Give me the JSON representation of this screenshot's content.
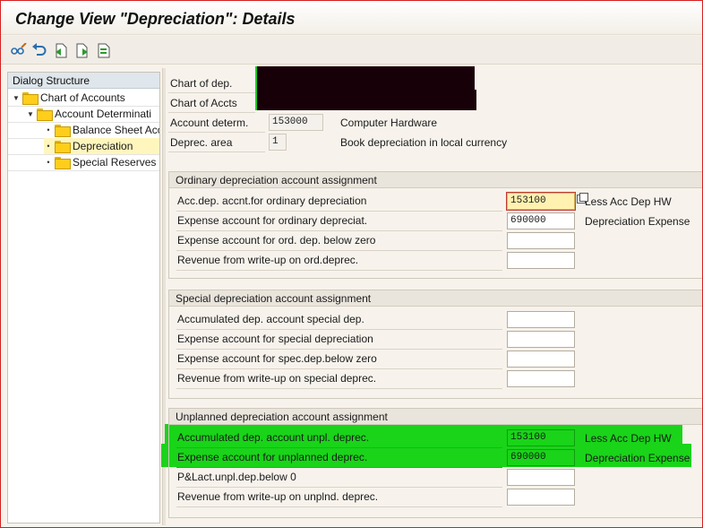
{
  "title": "Change View \"Depreciation\": Details",
  "toolbar": {
    "buttons": [
      {
        "name": "display-change-button",
        "icon": "glasses-pencil-icon"
      },
      {
        "name": "undo-button",
        "icon": "undo-icon"
      },
      {
        "name": "previous-entry-button",
        "icon": "previous-entry-icon"
      },
      {
        "name": "next-entry-button",
        "icon": "next-entry-icon"
      },
      {
        "name": "variable-list-button",
        "icon": "list-icon"
      }
    ]
  },
  "dialog_structure": {
    "heading": "Dialog Structure",
    "items": [
      {
        "label": "Chart of Accounts",
        "level": 0,
        "expanded": true
      },
      {
        "label": "Account Determinati",
        "level": 1,
        "expanded": true
      },
      {
        "label": "Balance Sheet Acc",
        "level": 2
      },
      {
        "label": "Depreciation",
        "level": 2,
        "selected": true
      },
      {
        "label": "Special Reserves",
        "level": 2
      }
    ]
  },
  "header_fields": {
    "chart_of_dep_label": "Chart of dep.",
    "chart_of_accts_label": "Chart of Accts",
    "account_determ_label": "Account determ.",
    "account_determ_value": "153000",
    "account_determ_text": "Computer Hardware",
    "deprec_area_label": "Deprec. area",
    "deprec_area_value": "1",
    "deprec_area_text": "Book depreciation in local currency"
  },
  "groups": {
    "ordinary": {
      "title": "Ordinary depreciation account assignment",
      "rows": [
        {
          "label": "Acc.dep. accnt.for ordinary depreciation",
          "value": "153100",
          "text": "Less Acc Dep HW"
        },
        {
          "label": "Expense account for ordinary depreciat.",
          "value": "690000",
          "text": "Depreciation Expense"
        },
        {
          "label": "Expense account for ord. dep. below zero",
          "value": "",
          "text": ""
        },
        {
          "label": "Revenue from write-up on ord.deprec.",
          "value": "",
          "text": ""
        }
      ]
    },
    "special": {
      "title": "Special depreciation account assignment",
      "rows": [
        {
          "label": "Accumulated dep. account special dep.",
          "value": "",
          "text": ""
        },
        {
          "label": "Expense account for special depreciation",
          "value": "",
          "text": ""
        },
        {
          "label": "Expense account for spec.dep.below zero",
          "value": "",
          "text": ""
        },
        {
          "label": "Revenue from write-up on special deprec.",
          "value": "",
          "text": ""
        }
      ]
    },
    "unplanned": {
      "title": "Unplanned depreciation account assignment",
      "rows": [
        {
          "label": "Accumulated dep. account unpl. deprec.",
          "value": "153100",
          "text": "Less Acc Dep HW"
        },
        {
          "label": "Expense account for unplanned deprec.",
          "value": "690000",
          "text": "Depreciation Expense"
        },
        {
          "label": "P&Lact.unpl.dep.below 0",
          "value": "",
          "text": ""
        },
        {
          "label": "Revenue from write-up on unplnd. deprec.",
          "value": "",
          "text": ""
        }
      ]
    }
  },
  "colors": {
    "highlight": "#19d419",
    "selected_tree_item": "#fff6bd",
    "redaction": "#180008"
  }
}
